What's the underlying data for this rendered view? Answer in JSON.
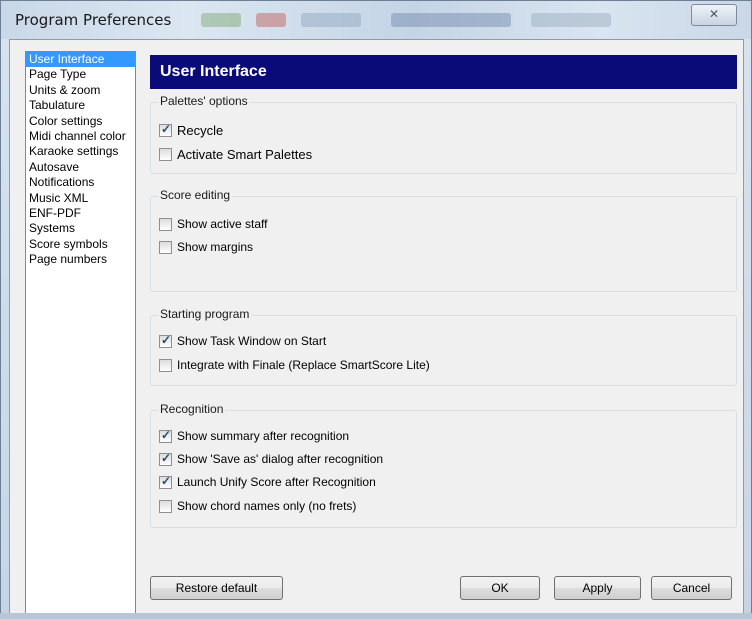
{
  "window": {
    "title": "Program Preferences",
    "close_glyph": "✕"
  },
  "categories": [
    {
      "label": "User Interface",
      "selected": true
    },
    {
      "label": "Page Type"
    },
    {
      "label": "Units & zoom"
    },
    {
      "label": "Tabulature"
    },
    {
      "label": "Color settings"
    },
    {
      "label": "Midi channel color"
    },
    {
      "label": "Karaoke settings"
    },
    {
      "label": "Autosave"
    },
    {
      "label": "Notifications"
    },
    {
      "label": "Music XML"
    },
    {
      "label": "ENF-PDF"
    },
    {
      "label": "Systems"
    },
    {
      "label": "Score symbols"
    },
    {
      "label": "Page numbers"
    }
  ],
  "panel": {
    "header": "User Interface",
    "groups": [
      {
        "title": "Palettes' options",
        "options": [
          {
            "label": "Recycle",
            "checked": true
          },
          {
            "label": "Activate Smart Palettes",
            "checked": false
          }
        ]
      },
      {
        "title": "Score editing",
        "options": [
          {
            "label": "Show active staff",
            "checked": false
          },
          {
            "label": "Show margins",
            "checked": false
          }
        ]
      },
      {
        "title": "Starting program",
        "options": [
          {
            "label": "Show Task Window on Start",
            "checked": true
          },
          {
            "label": "Integrate with Finale (Replace SmartScore Lite)",
            "checked": false
          }
        ]
      },
      {
        "title": "Recognition",
        "options": [
          {
            "label": "Show summary after recognition",
            "checked": true
          },
          {
            "label": "Show 'Save as' dialog after recognition",
            "checked": true
          },
          {
            "label": "Launch Unify Score after Recognition",
            "checked": true
          },
          {
            "label": "Show chord names only (no frets)",
            "checked": false
          }
        ]
      }
    ]
  },
  "buttons": {
    "restore": "Restore default",
    "ok": "OK",
    "apply": "Apply",
    "cancel": "Cancel"
  },
  "check_glyph": "✓"
}
